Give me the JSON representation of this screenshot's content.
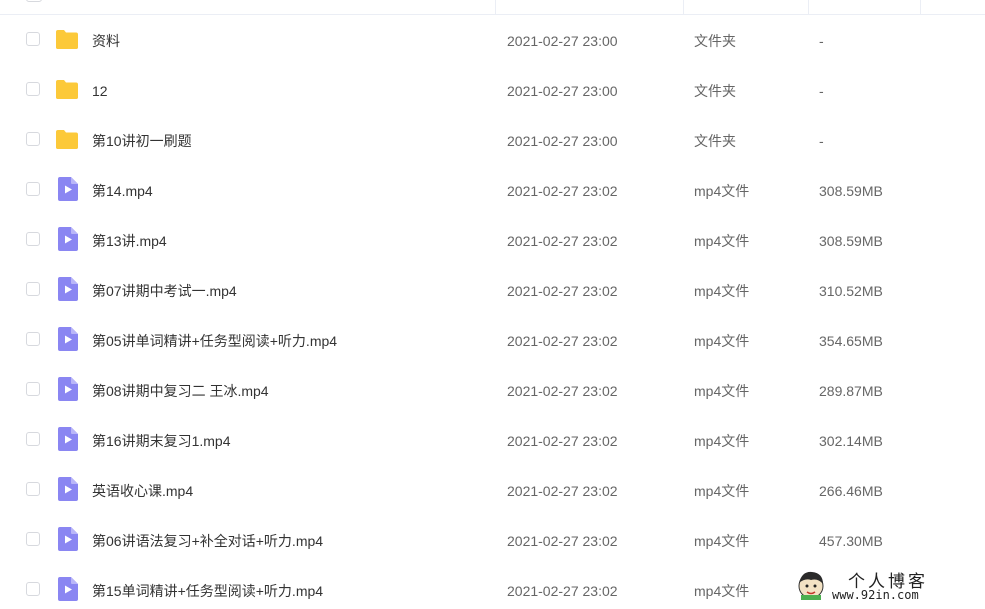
{
  "files": [
    {
      "name": "资料",
      "kind": "folder",
      "time": "2021-02-27 23:00",
      "type": "文件夹",
      "size": "-"
    },
    {
      "name": "12",
      "kind": "folder",
      "time": "2021-02-27 23:00",
      "type": "文件夹",
      "size": "-"
    },
    {
      "name": "第10讲初一刷题",
      "kind": "folder",
      "time": "2021-02-27 23:00",
      "type": "文件夹",
      "size": "-"
    },
    {
      "name": "第14.mp4",
      "kind": "video",
      "time": "2021-02-27 23:02",
      "type": "mp4文件",
      "size": "308.59MB"
    },
    {
      "name": "第13讲.mp4",
      "kind": "video",
      "time": "2021-02-27 23:02",
      "type": "mp4文件",
      "size": "308.59MB"
    },
    {
      "name": "第07讲期中考试一.mp4",
      "kind": "video",
      "time": "2021-02-27 23:02",
      "type": "mp4文件",
      "size": "310.52MB"
    },
    {
      "name": "第05讲单词精讲+任务型阅读+听力.mp4",
      "kind": "video",
      "time": "2021-02-27 23:02",
      "type": "mp4文件",
      "size": "354.65MB"
    },
    {
      "name": "第08讲期中复习二 王冰.mp4",
      "kind": "video",
      "time": "2021-02-27 23:02",
      "type": "mp4文件",
      "size": "289.87MB"
    },
    {
      "name": "第16讲期末复习1.mp4",
      "kind": "video",
      "time": "2021-02-27 23:02",
      "type": "mp4文件",
      "size": "302.14MB"
    },
    {
      "name": "英语收心课.mp4",
      "kind": "video",
      "time": "2021-02-27 23:02",
      "type": "mp4文件",
      "size": "266.46MB"
    },
    {
      "name": "第06讲语法复习+补全对话+听力.mp4",
      "kind": "video",
      "time": "2021-02-27 23:02",
      "type": "mp4文件",
      "size": "457.30MB"
    },
    {
      "name": "第15单词精讲+任务型阅读+听力.mp4",
      "kind": "video",
      "time": "2021-02-27 23:02",
      "type": "mp4文件",
      "size": ""
    }
  ],
  "icons": {
    "folder": "folder-icon",
    "video": "video-file-icon"
  },
  "colors": {
    "folder": "#fcc93a",
    "video": "#8a86f2"
  },
  "watermark": {
    "title": "个人博客",
    "url": "www.92in.com"
  }
}
